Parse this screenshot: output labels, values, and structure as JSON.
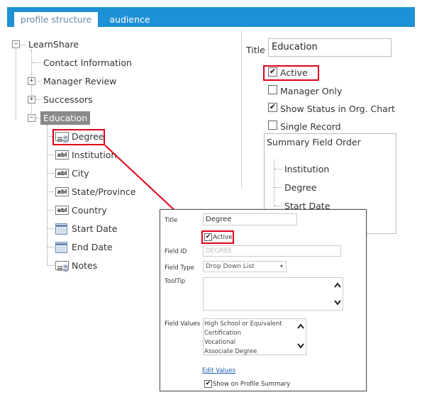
{
  "tabs": [
    {
      "label": "profile structure",
      "active": true
    },
    {
      "label": "audience",
      "active": false
    }
  ],
  "tree": {
    "root": "LearnShare",
    "children": [
      "Contact Information",
      "Manager Review",
      "Successors",
      "Education"
    ],
    "education_fields": [
      "Degree",
      "Institution",
      "City",
      "State/Province",
      "Country",
      "Start Date",
      "End Date",
      "Notes"
    ]
  },
  "right_panel": {
    "title_label": "Title",
    "title_value": "Education",
    "options": [
      {
        "label": "Active",
        "checked": true
      },
      {
        "label": "Manager Only",
        "checked": false
      },
      {
        "label": "Show Status in Org. Chart",
        "checked": true
      },
      {
        "label": "Single Record",
        "checked": false
      }
    ],
    "summary_header": "Summary Field Order",
    "summary_items": [
      "Institution",
      "Degree",
      "Start Date"
    ]
  },
  "popup": {
    "title_label": "Title",
    "title_value": "Degree",
    "active_label": "Active",
    "active_checked": true,
    "field_id_label": "Field ID",
    "field_id_value": "DEGREE",
    "field_type_label": "Field Type",
    "field_type_value": "Drop Down List",
    "tooltip_label": "ToolTip",
    "field_values_label": "Field Values",
    "field_values": [
      "High School or Equivalent",
      "Certification",
      "Vocational",
      "Associate Degree"
    ],
    "edit_values_label": "Edit Values",
    "show_summary_label": "Show on Profile Summary",
    "show_summary_checked": true
  },
  "colors": {
    "tab_bar": "#1e90d6",
    "highlight": "#e0001a",
    "selected_node": "#8a8a8a",
    "link": "#1a5fb4"
  },
  "icons": {
    "checkmark": "✔",
    "expand": "+",
    "collapse": "−",
    "scroll_up": "⌃",
    "scroll_down": "⌄",
    "dropdown": "▾"
  }
}
